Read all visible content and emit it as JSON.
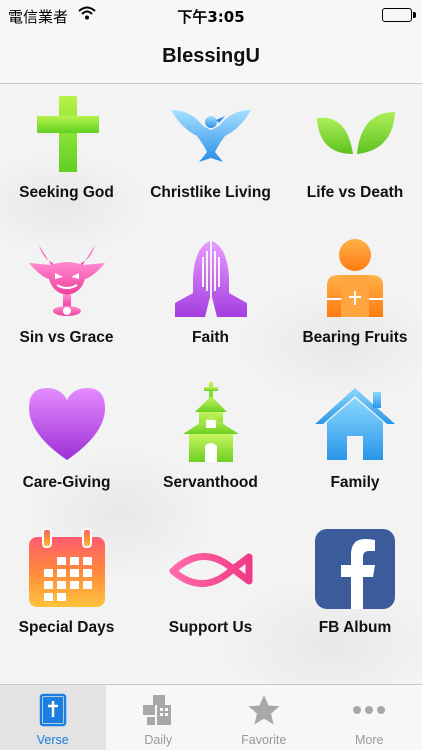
{
  "status_bar": {
    "carrier": "電信業者",
    "time": "下午3:05"
  },
  "nav": {
    "title": "BlessingU"
  },
  "grid_items": [
    {
      "label": "Seeking God",
      "icon": "cross-icon"
    },
    {
      "label": "Christlike Living",
      "icon": "dove-icon"
    },
    {
      "label": "Life vs Death",
      "icon": "leaves-icon"
    },
    {
      "label": "Sin vs Grace",
      "icon": "devil-icon"
    },
    {
      "label": "Faith",
      "icon": "praying-hands-icon"
    },
    {
      "label": "Bearing Fruits",
      "icon": "person-icon"
    },
    {
      "label": "Care-Giving",
      "icon": "heart-icon"
    },
    {
      "label": "Servanthood",
      "icon": "church-icon"
    },
    {
      "label": "Family",
      "icon": "house-icon"
    },
    {
      "label": "Special Days",
      "icon": "calendar-icon"
    },
    {
      "label": "Support Us",
      "icon": "fish-icon"
    },
    {
      "label": "FB Album",
      "icon": "facebook-icon"
    }
  ],
  "tabs": [
    {
      "label": "Verse",
      "icon": "bible-icon",
      "selected": true
    },
    {
      "label": "Daily",
      "icon": "daily-icon",
      "selected": false
    },
    {
      "label": "Favorite",
      "icon": "star-icon",
      "selected": false
    },
    {
      "label": "More",
      "icon": "more-icon",
      "selected": false
    }
  ],
  "colors": {
    "tab_active": "#1a7fe0",
    "tab_inactive": "#9a9a9a"
  }
}
